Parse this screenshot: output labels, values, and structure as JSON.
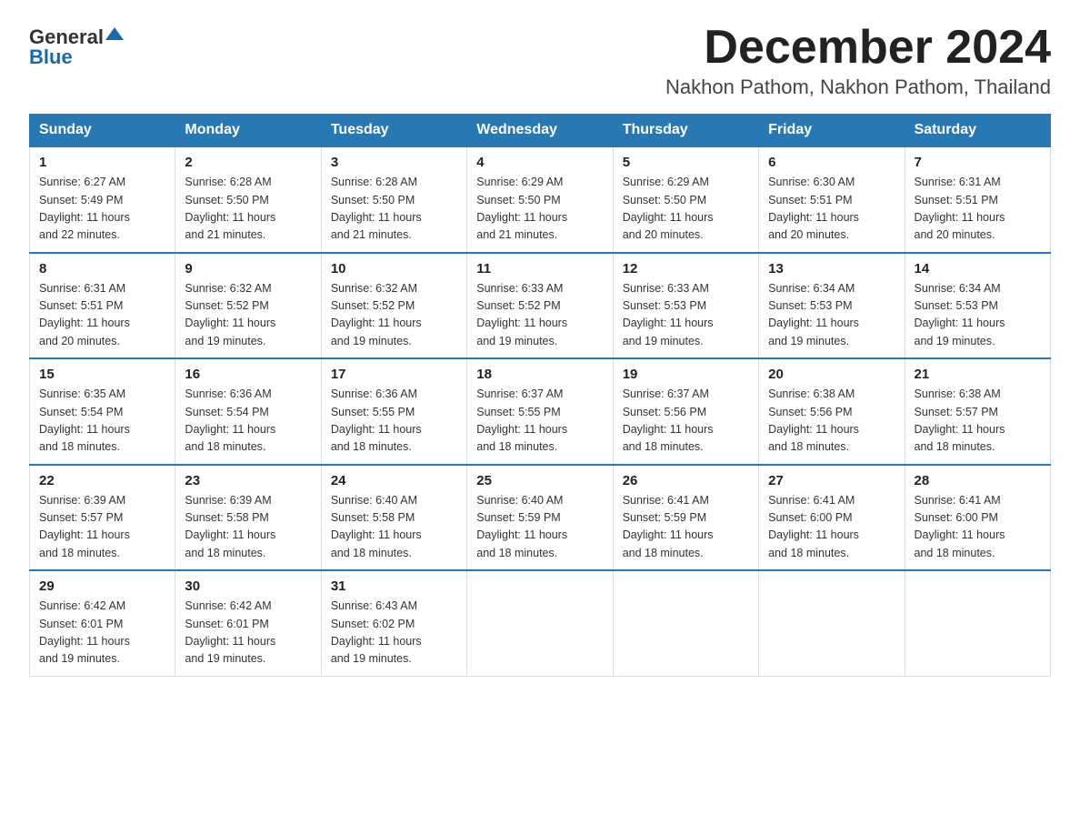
{
  "header": {
    "logo_general": "General",
    "logo_blue": "Blue",
    "title": "December 2024",
    "subtitle": "Nakhon Pathom, Nakhon Pathom, Thailand"
  },
  "calendar": {
    "days_of_week": [
      "Sunday",
      "Monday",
      "Tuesday",
      "Wednesday",
      "Thursday",
      "Friday",
      "Saturday"
    ],
    "weeks": [
      [
        {
          "day": "1",
          "sunrise": "6:27 AM",
          "sunset": "5:49 PM",
          "daylight": "11 hours and 22 minutes."
        },
        {
          "day": "2",
          "sunrise": "6:28 AM",
          "sunset": "5:50 PM",
          "daylight": "11 hours and 21 minutes."
        },
        {
          "day": "3",
          "sunrise": "6:28 AM",
          "sunset": "5:50 PM",
          "daylight": "11 hours and 21 minutes."
        },
        {
          "day": "4",
          "sunrise": "6:29 AM",
          "sunset": "5:50 PM",
          "daylight": "11 hours and 21 minutes."
        },
        {
          "day": "5",
          "sunrise": "6:29 AM",
          "sunset": "5:50 PM",
          "daylight": "11 hours and 20 minutes."
        },
        {
          "day": "6",
          "sunrise": "6:30 AM",
          "sunset": "5:51 PM",
          "daylight": "11 hours and 20 minutes."
        },
        {
          "day": "7",
          "sunrise": "6:31 AM",
          "sunset": "5:51 PM",
          "daylight": "11 hours and 20 minutes."
        }
      ],
      [
        {
          "day": "8",
          "sunrise": "6:31 AM",
          "sunset": "5:51 PM",
          "daylight": "11 hours and 20 minutes."
        },
        {
          "day": "9",
          "sunrise": "6:32 AM",
          "sunset": "5:52 PM",
          "daylight": "11 hours and 19 minutes."
        },
        {
          "day": "10",
          "sunrise": "6:32 AM",
          "sunset": "5:52 PM",
          "daylight": "11 hours and 19 minutes."
        },
        {
          "day": "11",
          "sunrise": "6:33 AM",
          "sunset": "5:52 PM",
          "daylight": "11 hours and 19 minutes."
        },
        {
          "day": "12",
          "sunrise": "6:33 AM",
          "sunset": "5:53 PM",
          "daylight": "11 hours and 19 minutes."
        },
        {
          "day": "13",
          "sunrise": "6:34 AM",
          "sunset": "5:53 PM",
          "daylight": "11 hours and 19 minutes."
        },
        {
          "day": "14",
          "sunrise": "6:34 AM",
          "sunset": "5:53 PM",
          "daylight": "11 hours and 19 minutes."
        }
      ],
      [
        {
          "day": "15",
          "sunrise": "6:35 AM",
          "sunset": "5:54 PM",
          "daylight": "11 hours and 18 minutes."
        },
        {
          "day": "16",
          "sunrise": "6:36 AM",
          "sunset": "5:54 PM",
          "daylight": "11 hours and 18 minutes."
        },
        {
          "day": "17",
          "sunrise": "6:36 AM",
          "sunset": "5:55 PM",
          "daylight": "11 hours and 18 minutes."
        },
        {
          "day": "18",
          "sunrise": "6:37 AM",
          "sunset": "5:55 PM",
          "daylight": "11 hours and 18 minutes."
        },
        {
          "day": "19",
          "sunrise": "6:37 AM",
          "sunset": "5:56 PM",
          "daylight": "11 hours and 18 minutes."
        },
        {
          "day": "20",
          "sunrise": "6:38 AM",
          "sunset": "5:56 PM",
          "daylight": "11 hours and 18 minutes."
        },
        {
          "day": "21",
          "sunrise": "6:38 AM",
          "sunset": "5:57 PM",
          "daylight": "11 hours and 18 minutes."
        }
      ],
      [
        {
          "day": "22",
          "sunrise": "6:39 AM",
          "sunset": "5:57 PM",
          "daylight": "11 hours and 18 minutes."
        },
        {
          "day": "23",
          "sunrise": "6:39 AM",
          "sunset": "5:58 PM",
          "daylight": "11 hours and 18 minutes."
        },
        {
          "day": "24",
          "sunrise": "6:40 AM",
          "sunset": "5:58 PM",
          "daylight": "11 hours and 18 minutes."
        },
        {
          "day": "25",
          "sunrise": "6:40 AM",
          "sunset": "5:59 PM",
          "daylight": "11 hours and 18 minutes."
        },
        {
          "day": "26",
          "sunrise": "6:41 AM",
          "sunset": "5:59 PM",
          "daylight": "11 hours and 18 minutes."
        },
        {
          "day": "27",
          "sunrise": "6:41 AM",
          "sunset": "6:00 PM",
          "daylight": "11 hours and 18 minutes."
        },
        {
          "day": "28",
          "sunrise": "6:41 AM",
          "sunset": "6:00 PM",
          "daylight": "11 hours and 18 minutes."
        }
      ],
      [
        {
          "day": "29",
          "sunrise": "6:42 AM",
          "sunset": "6:01 PM",
          "daylight": "11 hours and 19 minutes."
        },
        {
          "day": "30",
          "sunrise": "6:42 AM",
          "sunset": "6:01 PM",
          "daylight": "11 hours and 19 minutes."
        },
        {
          "day": "31",
          "sunrise": "6:43 AM",
          "sunset": "6:02 PM",
          "daylight": "11 hours and 19 minutes."
        },
        null,
        null,
        null,
        null
      ]
    ],
    "labels": {
      "sunrise": "Sunrise:",
      "sunset": "Sunset:",
      "daylight": "Daylight:"
    }
  }
}
